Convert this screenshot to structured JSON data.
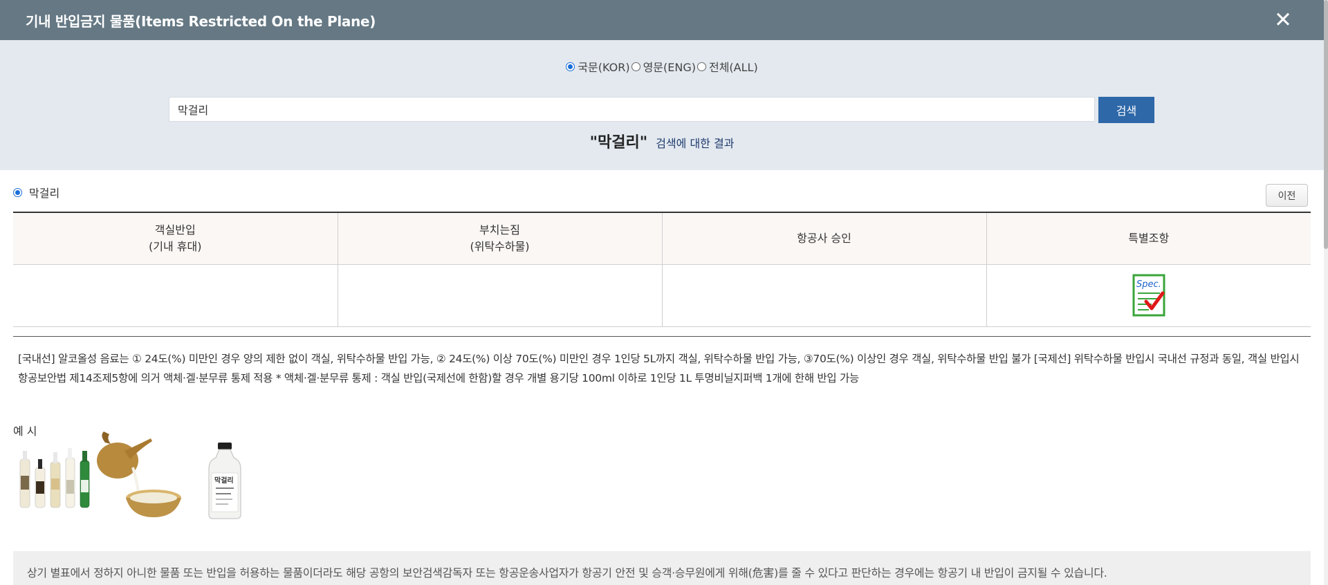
{
  "header": {
    "title": "기내 반입금지 물품(Items Restricted On the Plane)",
    "close_icon": "close-icon"
  },
  "language_options": [
    {
      "label": "국문(KOR)",
      "checked": true
    },
    {
      "label": "영문(ENG)",
      "checked": false
    },
    {
      "label": "전체(ALL)",
      "checked": false
    }
  ],
  "search": {
    "value": "막걸리",
    "button_label": "검색"
  },
  "result": {
    "query_display": "\"막걸리\"",
    "suffix": "검색에 대한 결과"
  },
  "item": {
    "label": "막걸리",
    "prev_label": "이전"
  },
  "table": {
    "headers": [
      {
        "line1": "객실반입",
        "line2": "(기내 휴대)"
      },
      {
        "line1": "부치는짐",
        "line2": "(위탁수하물)"
      },
      {
        "line1": "항공사 승인",
        "line2": ""
      },
      {
        "line1": "특별조항",
        "line2": ""
      }
    ],
    "special_icon": "spec-check-icon",
    "special_icon_text": "Spec."
  },
  "description": "[국내선] 알코올성 음료는 ① 24도(%) 미만인 경우 양의 제한 없이 객실, 위탁수하물 반입 가능, ② 24도(%) 이상 70도(%) 미만인 경우 1인당 5L까지 객실, 위탁수하물 반입 가능, ③70도(%) 이상인 경우 객실, 위탁수하물 반입 불가 [국제선] 위탁수하물 반입시 국내선 규정과 동일, 객실 반입시 항공보안법 제14조제5항에 의거 액체·겔·분무류 통제 적용 * 액체·겔·분무류 통제 : 객실 반입(국제선에 한함)할 경우 개별 용기당 100ml 이하로 1인당 1L 투명비닐지퍼백 1개에 한해 반입 가능",
  "example": {
    "label": "예 시",
    "images": [
      "makgeolli-bottles-image",
      "makgeolli-pouring-image",
      "makgeolli-bottle-image"
    ],
    "bottle_label": "막걸리"
  },
  "notice": "상기 별표에서 정하지 아니한 물품 또는 반입을 허용하는 물품이더라도 해당 공항의 보안검색감독자 또는 항공운송사업자가 항공기 안전 및 승객·승무원에게 위해(危害)를 줄 수 있다고 판단하는 경우에는 항공기 내 반입이 금지될 수 있습니다."
}
